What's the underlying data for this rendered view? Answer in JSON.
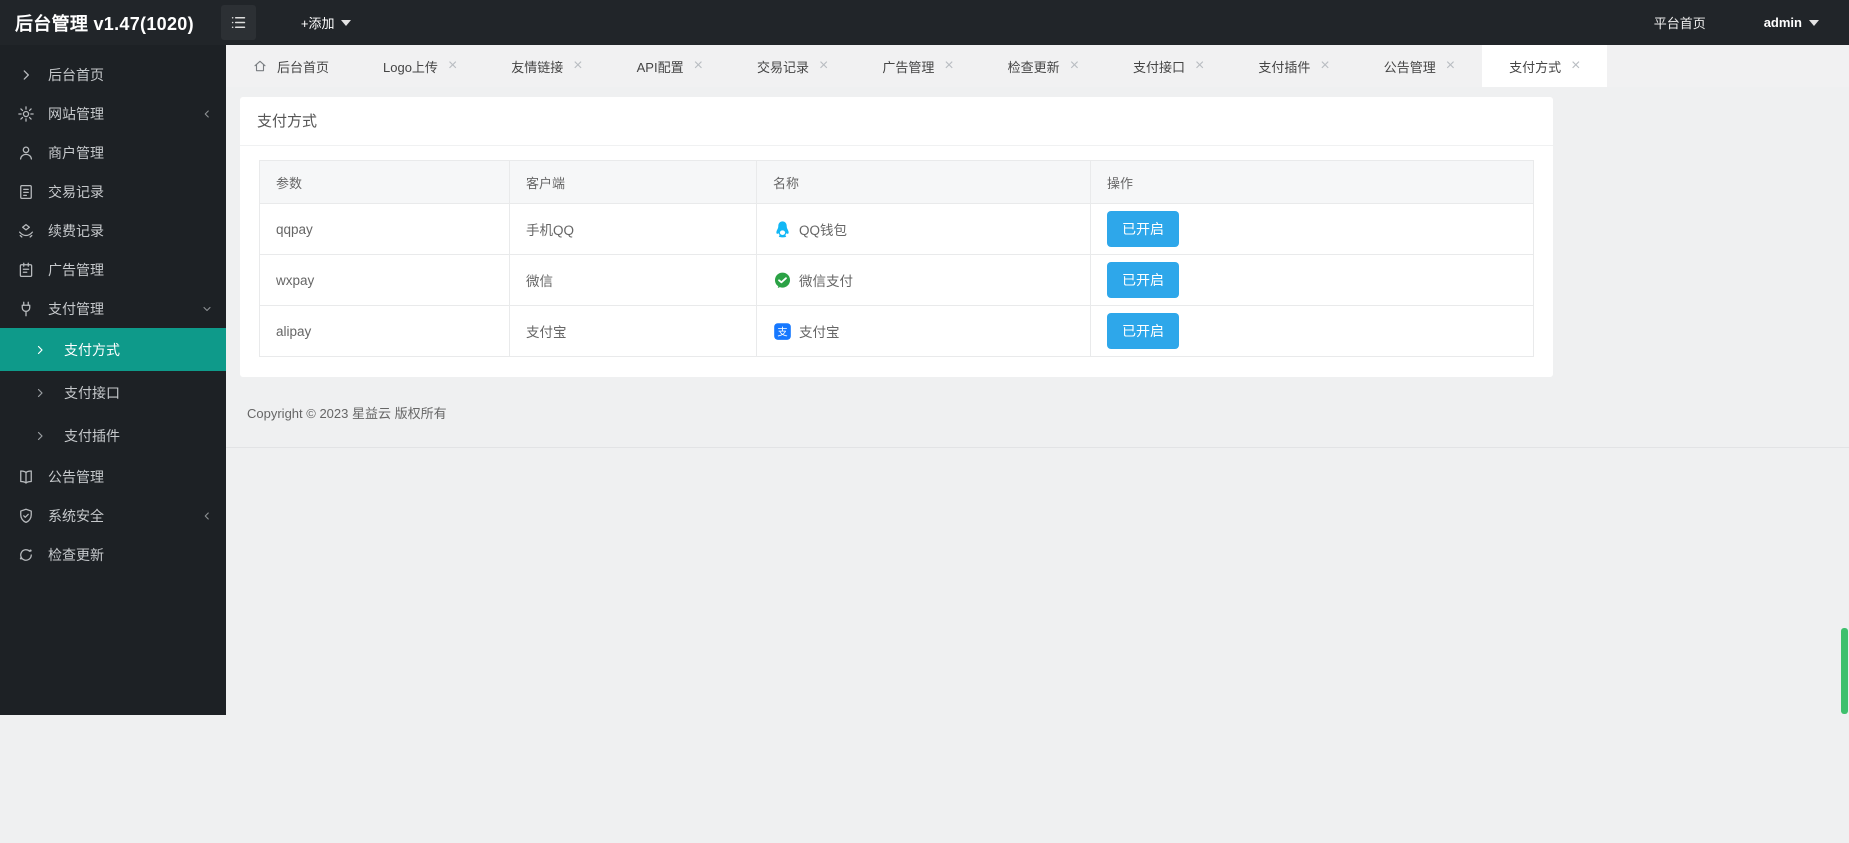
{
  "header": {
    "title": "后台管理 v1.47(1020)",
    "add_label": "+添加",
    "platform_home": "平台首页",
    "username": "admin"
  },
  "sidebar": {
    "items": [
      {
        "label": "后台首页",
        "icon": "chevron-right-icon"
      },
      {
        "label": "网站管理",
        "icon": "gear-icon",
        "arrow": "collapsed-left"
      },
      {
        "label": "商户管理",
        "icon": "user-icon"
      },
      {
        "label": "交易记录",
        "icon": "document-icon"
      },
      {
        "label": "续费记录",
        "icon": "renewal-icon"
      },
      {
        "label": "广告管理",
        "icon": "clipboard-icon"
      },
      {
        "label": "支付管理",
        "icon": "plug-icon",
        "arrow": "expanded-down"
      },
      {
        "label": "公告管理",
        "icon": "book-icon"
      },
      {
        "label": "系统安全",
        "icon": "shield-icon",
        "arrow": "collapsed-left"
      },
      {
        "label": "检查更新",
        "icon": "update-icon"
      }
    ],
    "submenu": [
      {
        "label": "支付方式",
        "active": true
      },
      {
        "label": "支付接口",
        "active": false
      },
      {
        "label": "支付插件",
        "active": false
      }
    ]
  },
  "tabs": [
    {
      "label": "后台首页",
      "home": true,
      "closable": false,
      "active": false
    },
    {
      "label": "Logo上传",
      "closable": true,
      "active": false
    },
    {
      "label": "友情链接",
      "closable": true,
      "active": false
    },
    {
      "label": "API配置",
      "closable": true,
      "active": false
    },
    {
      "label": "交易记录",
      "closable": true,
      "active": false
    },
    {
      "label": "广告管理",
      "closable": true,
      "active": false
    },
    {
      "label": "检查更新",
      "closable": true,
      "active": false
    },
    {
      "label": "支付接口",
      "closable": true,
      "active": false
    },
    {
      "label": "支付插件",
      "closable": true,
      "active": false
    },
    {
      "label": "公告管理",
      "closable": true,
      "active": false
    },
    {
      "label": "支付方式",
      "closable": true,
      "active": true
    }
  ],
  "page": {
    "title": "支付方式"
  },
  "table": {
    "columns": [
      "参数",
      "客户端",
      "名称",
      "操作"
    ],
    "rows": [
      {
        "param": "qqpay",
        "client": "手机QQ",
        "name": "QQ钱包",
        "icon": "qq-wallet-icon",
        "action": "已开启"
      },
      {
        "param": "wxpay",
        "client": "微信",
        "name": "微信支付",
        "icon": "wechat-pay-icon",
        "action": "已开启"
      },
      {
        "param": "alipay",
        "client": "支付宝",
        "name": "支付宝",
        "icon": "alipay-icon",
        "action": "已开启"
      }
    ]
  },
  "footer": {
    "copyright": "Copyright © 2023 星益云 版权所有"
  },
  "icons": {
    "close": "×"
  },
  "colors": {
    "header_bg": "#212529",
    "sidebar_bg": "#1d2125",
    "active_menu_teal": "#0e9a8a",
    "button_blue": "#2ea7ea",
    "qq_blue": "#12b7f5",
    "wechat_green": "#2ba245",
    "alipay_blue": "#1678ff",
    "scrollbar_green": "#3ec06d"
  }
}
